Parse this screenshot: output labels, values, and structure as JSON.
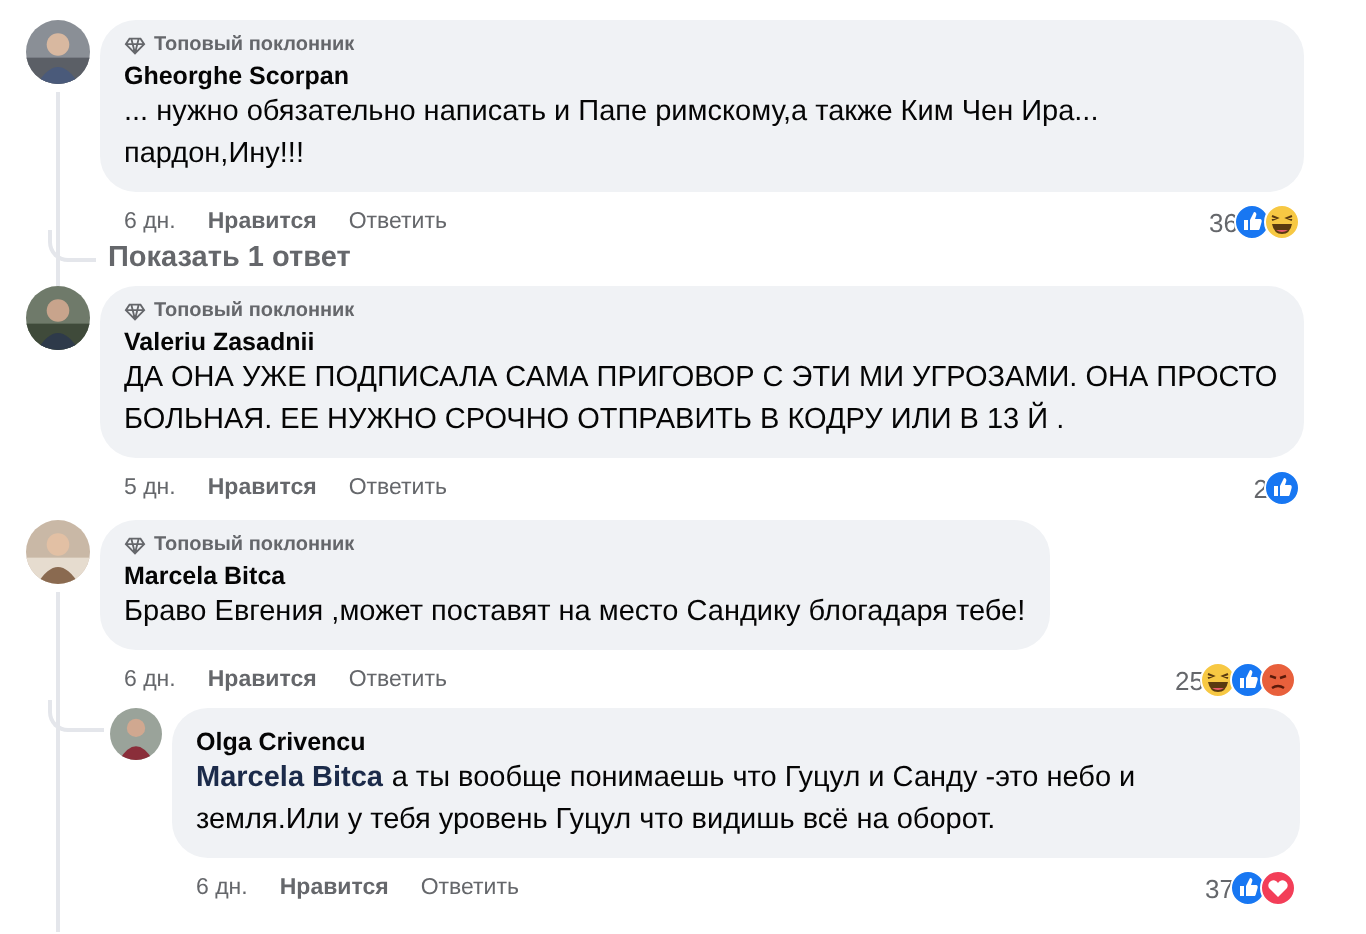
{
  "comments": [
    {
      "badge": "Топовый поклонник",
      "author": "Gheorghe Scorpan",
      "text": "... нужно обязательно написать и Папе римскому,а также Ким Чен Ира... пардон,Ину!!!",
      "time": "6 дн.",
      "like": "Нравится",
      "reply": "Ответить",
      "reaction_count": "36",
      "reactions": [
        {
          "kind": "like"
        },
        {
          "kind": "haha"
        }
      ],
      "show_replies": "Показать 1 ответ"
    },
    {
      "badge": "Топовый поклонник",
      "author": "Valeriu Zasadnii",
      "text": "ДА ОНА УЖЕ ПОДПИСАЛА САМА ПРИГОВОР С ЭТИ МИ УГРОЗАМИ. ОНА ПРОСТО БОЛЬНАЯ. ЕЕ НУЖНО СРОЧНО ОТПРАВИТЬ В КОДРУ ИЛИ В 13 Й .",
      "time": "5 дн.",
      "like": "Нравится",
      "reply": "Ответить",
      "reaction_count": "2",
      "reactions": [
        {
          "kind": "like"
        }
      ]
    },
    {
      "badge": "Топовый поклонник",
      "author": "Marcela Bitca",
      "text": "Браво Евгения ,может поставят на место Сандику блогадаря тебе!",
      "time": "6 дн.",
      "like": "Нравится",
      "reply": "Ответить",
      "reaction_count": "25",
      "reactions": [
        {
          "kind": "haha"
        },
        {
          "kind": "like"
        },
        {
          "kind": "angry"
        }
      ],
      "children": [
        {
          "author": "Olga Crivencu",
          "mention": "Marcela Bitca",
          "text": "а ты вообще понимаешь что Гуцул и Санду -это небо и земля.Или у тебя уровень Гуцул что видишь всё на оборот.",
          "time": "6 дн.",
          "like": "Нравится",
          "reply": "Ответить",
          "reaction_count": "37",
          "reactions": [
            {
              "kind": "like"
            },
            {
              "kind": "love"
            }
          ]
        }
      ]
    }
  ]
}
